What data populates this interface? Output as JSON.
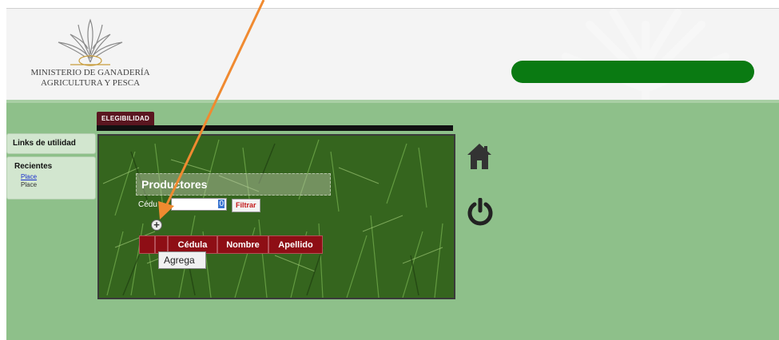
{
  "header": {
    "ministry_line1": "MINISTERIO DE GANADERÍA",
    "ministry_line2": "AGRICULTURA Y PESCA",
    "logo_icon": "sun-emblem-icon",
    "banner_color": "#0a7a12"
  },
  "sidebar": {
    "links_title": "Links de utilidad",
    "recent_title": "Recientes",
    "recent_link": "Place",
    "recent_text": "Place"
  },
  "tabs": {
    "active": "ELEGIBILIDAD"
  },
  "panel": {
    "title": "Productores",
    "cedula_label": "Cédu",
    "cedula_value": "0",
    "filter_label": "Filtrar",
    "table_headers": [
      "",
      "",
      "Cédula",
      "Nombre",
      "Apellido"
    ],
    "add_tooltip": "Agrega"
  },
  "side_icons": {
    "home": "home-icon",
    "power": "power-icon"
  },
  "colors": {
    "content_bg": "#8ec08a",
    "tab_bg": "#5a1620",
    "table_header": "#8e0e15",
    "annotation_arrow": "#f08a30"
  }
}
